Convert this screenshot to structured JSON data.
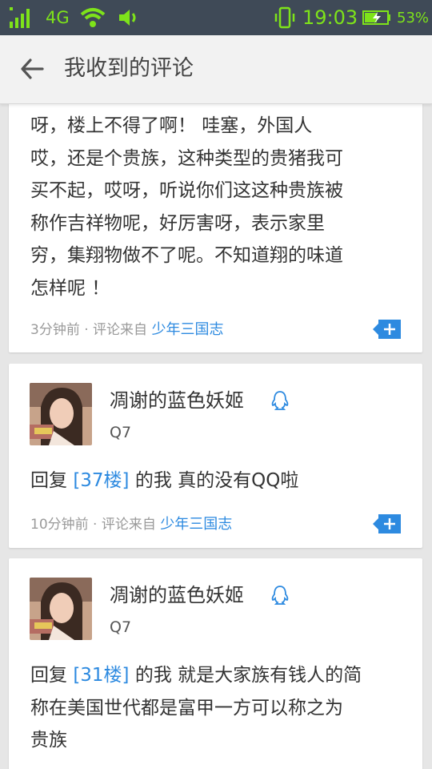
{
  "status_bar": {
    "network": "4G",
    "time": "19:03",
    "battery": "53%"
  },
  "header": {
    "title": "我收到的评论"
  },
  "comments": [
    {
      "body_lines": [
        "呀，楼上不得了啊！ 哇塞，外国人",
        "哎，还是个贵族，这种类型的贵猪我可",
        "买不起，哎呀，听说你们这这种贵族被",
        "称作吉祥物呢，好厉害呀，表示家里",
        "穷，集翔物做不了呢。不知道翔的味道",
        "怎样呢 ！"
      ],
      "time": "3分钟前",
      "source_prefix": "· 评论来自",
      "source": "少年三国志"
    },
    {
      "user": "凋谢的蓝色妖姬",
      "user_id": "Q7",
      "reply_prefix": "回复",
      "floor": "[37楼]",
      "reply_to": "的我",
      "text": "真的没有QQ啦",
      "time": "10分钟前",
      "source_prefix": "· 评论来自",
      "source": "少年三国志"
    },
    {
      "user": "凋谢的蓝色妖姬",
      "user_id": "Q7",
      "reply_prefix": "回复",
      "floor": "[31楼]",
      "reply_to": "的我",
      "text_lines": [
        "就是大家族有钱人的简",
        "称在美国世代都是富甲一方可以称之为",
        "贵族"
      ]
    }
  ],
  "colors": {
    "status_bar_bg": "#3f4a57",
    "status_icons": "#7ee31a",
    "accent": "#2d8ae0",
    "card_bg": "#ffffff",
    "page_bg": "#e6e6e6"
  }
}
